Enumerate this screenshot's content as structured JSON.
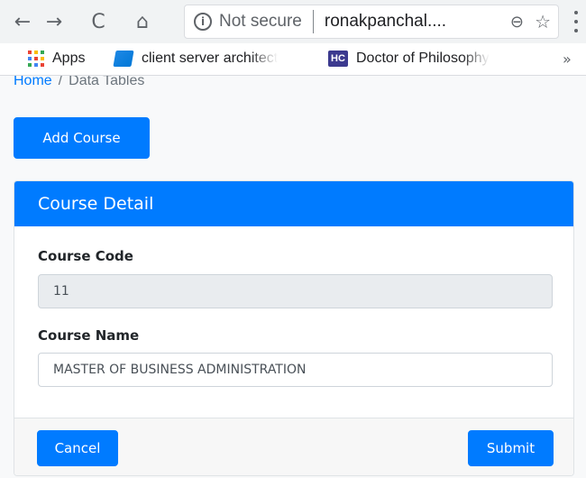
{
  "browser": {
    "back_icon": "←",
    "forward_icon": "→",
    "reload_icon": "C",
    "home_icon": "⌂",
    "info_icon": "i",
    "security_text": "Not secure",
    "url_text": "ronakpanchal....",
    "zoom_icon": "⊖",
    "star_icon": "☆"
  },
  "bookmarks": {
    "items": [
      {
        "label": "Apps",
        "icon": "apps-grid-icon"
      },
      {
        "label": "client server architect",
        "icon": "azure-icon"
      },
      {
        "label": "Doctor of Philosophy",
        "icon": "hc-icon",
        "icon_text": "HC"
      }
    ],
    "more_icon": "»"
  },
  "breadcrumb": {
    "home": "Home",
    "separator": "/",
    "current": "Data Tables"
  },
  "actions": {
    "add_course_label": "Add Course"
  },
  "card": {
    "title": "Course Detail",
    "course_code_label": "Course Code",
    "course_code_value": "11",
    "course_name_label": "Course Name",
    "course_name_value": "MASTER OF BUSINESS ADMINISTRATION",
    "cancel_label": "Cancel",
    "submit_label": "Submit"
  },
  "colors": {
    "primary": "#007bff",
    "page_bg": "#f8f9fa",
    "readonly_bg": "#e9ecef",
    "hc_icon_bg": "#3c3a8f"
  }
}
